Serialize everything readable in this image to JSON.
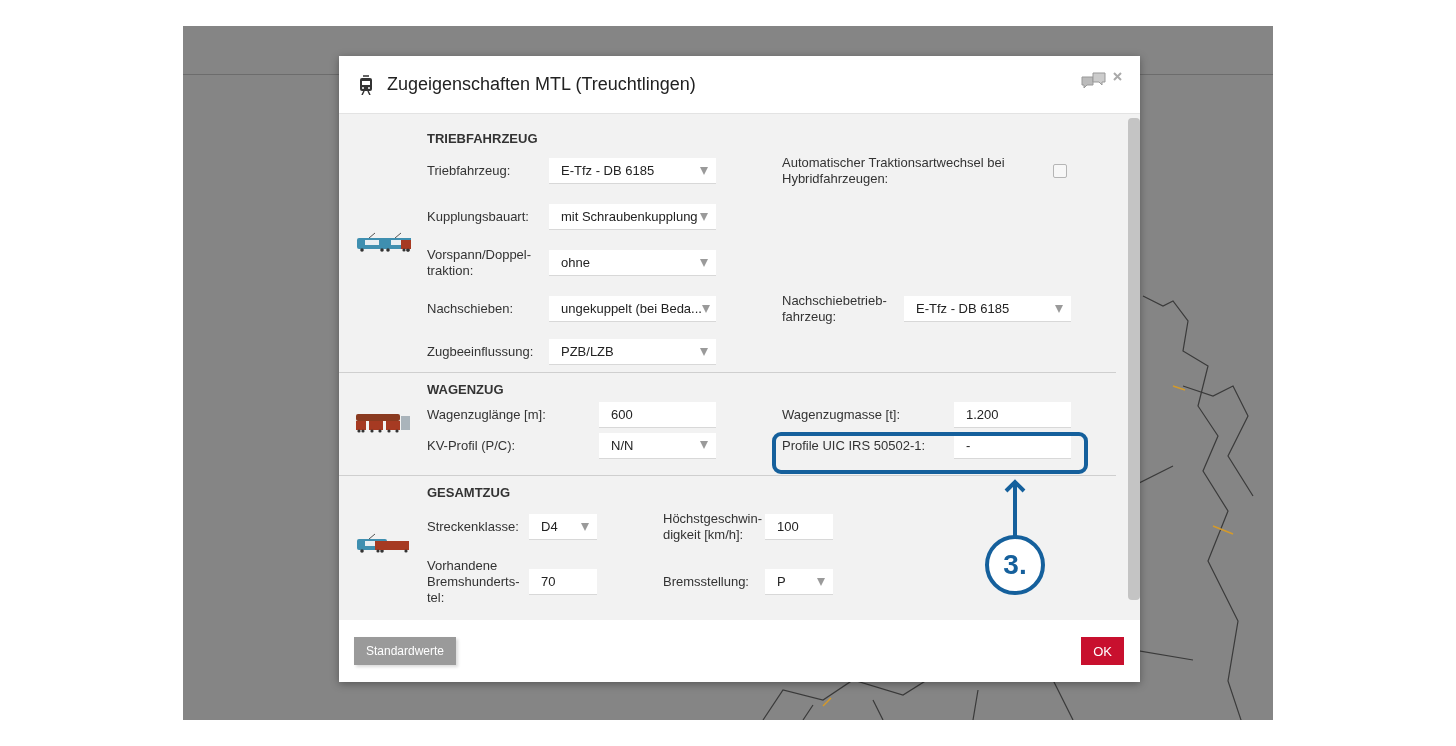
{
  "dialog": {
    "title": "Zugeigenschaften MTL (Treuchtlingen)",
    "sections": [
      {
        "heading": "TRIEBFAHRZEUG",
        "rows": [
          {
            "left": {
              "label": "Triebfahrzeug:",
              "kind": "select",
              "value": "E-Tfz - DB 6185"
            },
            "right": {
              "label": "Automatischer Traktionsartwechsel bei\nHybridfahrzeugen:",
              "kind": "checkbox",
              "checked": false
            }
          },
          {
            "left": {
              "label": "Kupplungsbauart:",
              "kind": "select",
              "value": "mit Schraubenkupplung"
            }
          },
          {
            "left": {
              "label": "Vorspann/Doppel-\ntraktion:",
              "kind": "select",
              "value": "ohne"
            }
          },
          {
            "left": {
              "label": "Nachschieben:",
              "kind": "select",
              "value": "ungekuppelt (bei Beda..."
            },
            "right": {
              "label": "Nachschiebetrieb-\nfahrzeug:",
              "kind": "select",
              "value": "E-Tfz - DB 6185"
            }
          },
          {
            "left": {
              "label": "Zugbeeinflussung:",
              "kind": "select",
              "value": "PZB/LZB"
            }
          }
        ]
      },
      {
        "heading": "WAGENZUG",
        "rows": [
          {
            "left": {
              "label": "Wagenzuglänge [m]:",
              "kind": "input",
              "value": "600"
            },
            "right": {
              "label": "Wagenzugmasse [t]:",
              "kind": "input",
              "value": "1.200"
            }
          },
          {
            "left": {
              "label": "KV-Profil (P/C):",
              "kind": "select",
              "value": "N/N"
            },
            "right": {
              "label": "Profile UIC IRS 50502-1:",
              "kind": "input",
              "value": "-"
            }
          }
        ]
      },
      {
        "heading": "GESAMTZUG",
        "rows": [
          {
            "left": {
              "label": "Streckenklasse:",
              "kind": "select",
              "value": "D4"
            },
            "right": {
              "label": "Höchstgeschwin-\ndigkeit [km/h]:",
              "kind": "input",
              "value": "100"
            }
          },
          {
            "left": {
              "label": "Vorhandene\nBremshunderts-\ntel:",
              "kind": "input",
              "value": "70"
            },
            "right": {
              "label": "Bremsstellung:",
              "kind": "select",
              "value": "P"
            }
          }
        ]
      }
    ],
    "buttons": [
      {
        "label": "Standardwerte",
        "kind": "secondary"
      },
      {
        "label": "OK",
        "kind": "primary"
      }
    ]
  },
  "annotation": {
    "label": "3."
  }
}
